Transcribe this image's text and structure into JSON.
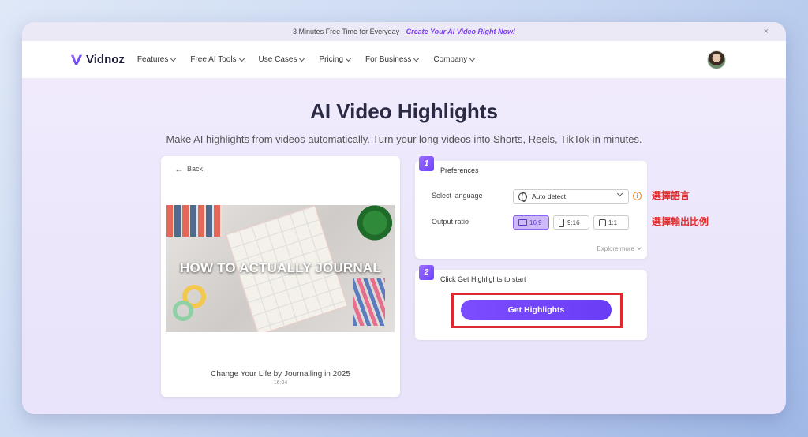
{
  "announcement": {
    "text": "3 Minutes Free Time for Everyday - ",
    "link": "Create Your AI Video Right Now!",
    "close": "×"
  },
  "nav": {
    "logo": "Vidnoz",
    "items": [
      "Features",
      "Free AI Tools",
      "Use Cases",
      "Pricing",
      "For Business",
      "Company"
    ]
  },
  "hero": {
    "title": "AI Video Highlights",
    "subtitle": "Make AI highlights from videos automatically. Turn your long videos into Shorts, Reels, TikTok in minutes."
  },
  "video": {
    "back": "Back",
    "overlay_text": "HOW TO ACTUALLY JOURNAL",
    "title": "Change Your Life by Journalling in 2025",
    "duration": "16:04"
  },
  "step1": {
    "badge": "1",
    "heading": "Preferences",
    "language_label": "Select language",
    "language_value": "Auto detect",
    "ratio_label": "Output ratio",
    "ratios": [
      "16:9",
      "9:16",
      "1:1"
    ],
    "selected_ratio": "16:9",
    "explore_more": "Explore more"
  },
  "step2": {
    "badge": "2",
    "heading": "Click Get Highlights to start",
    "button": "Get Highlights"
  },
  "annotations": {
    "language": "選擇語言",
    "ratio": "選擇輸出比例"
  },
  "colors": {
    "accent": "#6e44ff",
    "annotation": "#e03030"
  }
}
